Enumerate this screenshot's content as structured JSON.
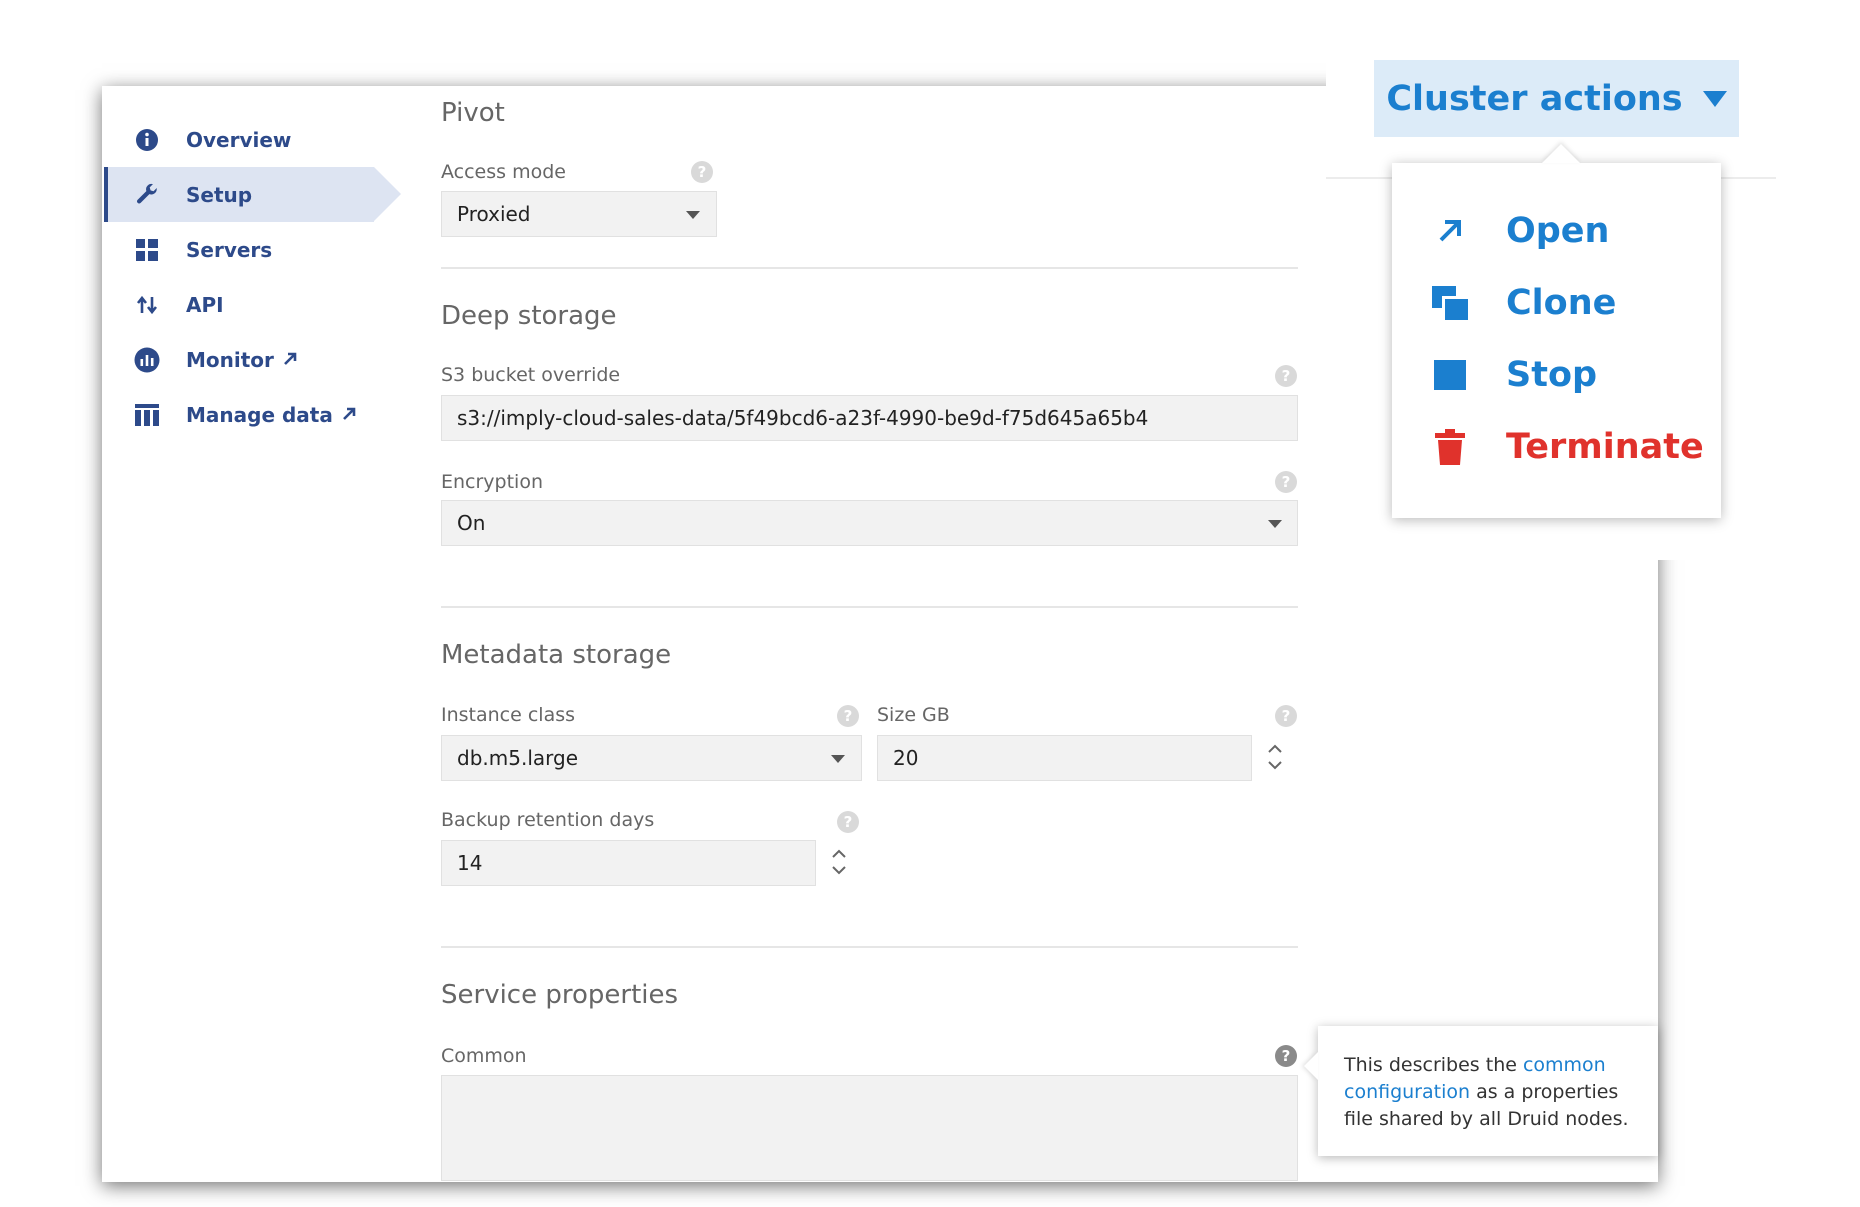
{
  "sidebar": {
    "items": [
      {
        "label": "Overview",
        "icon": "info-icon"
      },
      {
        "label": "Setup",
        "icon": "wrench-icon",
        "active": true
      },
      {
        "label": "Servers",
        "icon": "grid-icon"
      },
      {
        "label": "API",
        "icon": "arrows-up-down-icon"
      },
      {
        "label": "Monitor",
        "icon": "chart-icon",
        "external": true
      },
      {
        "label": "Manage data",
        "icon": "table-icon",
        "external": true
      }
    ]
  },
  "pivot": {
    "title": "Pivot",
    "access_mode_label": "Access mode",
    "access_mode_value": "Proxied"
  },
  "deep_storage": {
    "title": "Deep storage",
    "s3_label": "S3 bucket override",
    "s3_value": "s3://imply-cloud-sales-data/5f49bcd6-a23f-4990-be9d-f75d645a65b4",
    "encryption_label": "Encryption",
    "encryption_value": "On"
  },
  "metadata_storage": {
    "title": "Metadata storage",
    "instance_class_label": "Instance class",
    "instance_class_value": "db.m5.large",
    "size_label": "Size GB",
    "size_value": "20",
    "backup_label": "Backup retention days",
    "backup_value": "14"
  },
  "service_properties": {
    "title": "Service properties",
    "common_label": "Common",
    "common_value": ""
  },
  "cluster_actions": {
    "label": "Cluster actions",
    "items": [
      {
        "label": "Open",
        "icon": "external-arrow-icon"
      },
      {
        "label": "Clone",
        "icon": "clone-icon"
      },
      {
        "label": "Stop",
        "icon": "stop-icon"
      },
      {
        "label": "Terminate",
        "icon": "trash-icon",
        "danger": true
      }
    ]
  },
  "tooltip": {
    "prefix": "This describes the ",
    "link": "common configuration",
    "suffix": " as a properties file shared by all Druid nodes."
  },
  "help_glyph": "?",
  "colors": {
    "accent": "#1b7fcf",
    "nav": "#2d4a8a",
    "danger": "#e0322c",
    "button_bg": "#dcebf8"
  }
}
